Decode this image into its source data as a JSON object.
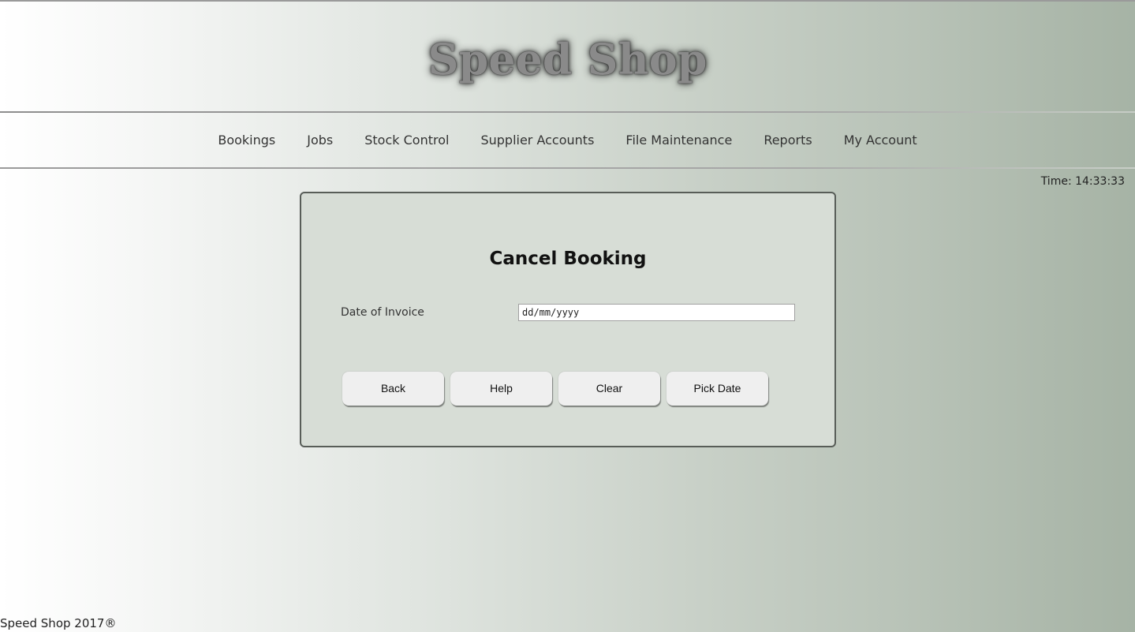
{
  "header": {
    "brand": "Speed Shop"
  },
  "nav": {
    "items": [
      {
        "label": "Bookings"
      },
      {
        "label": "Jobs"
      },
      {
        "label": "Stock Control"
      },
      {
        "label": "Supplier Accounts"
      },
      {
        "label": "File Maintenance"
      },
      {
        "label": "Reports"
      },
      {
        "label": "My Account"
      }
    ]
  },
  "clock": {
    "text": "Time: 14:33:33"
  },
  "form": {
    "title": "Cancel Booking",
    "date_label": "Date of Invoice",
    "date_value": "",
    "date_placeholder": "dd/mm/yyyy",
    "buttons": {
      "back": "Back",
      "help": "Help",
      "clear": "Clear",
      "pick_date": "Pick Date"
    }
  },
  "footer": {
    "text": "Speed Shop 2017®"
  }
}
